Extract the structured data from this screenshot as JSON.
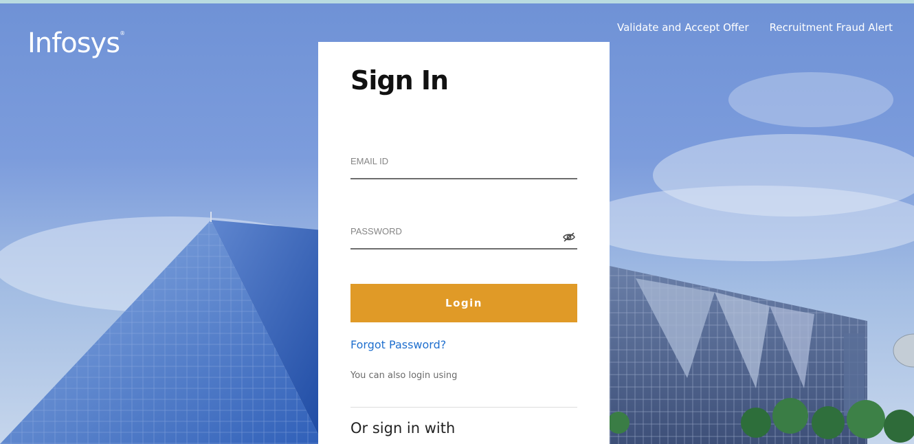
{
  "brand": {
    "logo_text": "Infosys",
    "logo_mark": "®"
  },
  "top_nav": {
    "validate_offer": "Validate and Accept Offer",
    "fraud_alert": "Recruitment Fraud Alert"
  },
  "signin": {
    "title": "Sign In",
    "email_placeholder": "EMAIL ID",
    "password_placeholder": "PASSWORD",
    "login_label": "Login",
    "forgot_password": "Forgot Password?",
    "also_login": "You can also login using",
    "or_sign_in_with": "Or sign in with"
  },
  "icons": {
    "password_toggle": "eye-slash-icon"
  },
  "colors": {
    "accent": "#e09a27",
    "link": "#1f6fce",
    "sky": "#7c9cdc",
    "top_strip": "#b9dbe0"
  }
}
